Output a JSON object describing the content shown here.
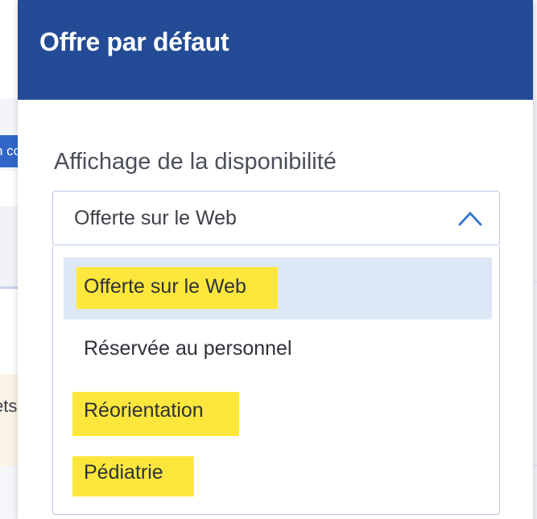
{
  "background": {
    "left_tab_fragment": "n co",
    "left_text_fragment": "ets"
  },
  "modal": {
    "title": "Offre par défaut",
    "field_label": "Affichage de la disponibilité",
    "select": {
      "value": "Offerte sur le Web",
      "chevron_icon": "chevron-up-icon"
    },
    "options": [
      {
        "label": "Offerte sur le Web",
        "selected": true,
        "highlighted": true
      },
      {
        "label": "Réservée au personnel",
        "selected": false,
        "highlighted": false
      },
      {
        "label": "Réorientation",
        "selected": false,
        "highlighted": true
      },
      {
        "label": "Pédiatrie",
        "selected": false,
        "highlighted": true
      }
    ]
  },
  "colors": {
    "header_bg": "#234b96",
    "selected_option_bg": "#dde8f7",
    "highlight": "#fde73c",
    "accent": "#3166c8"
  }
}
